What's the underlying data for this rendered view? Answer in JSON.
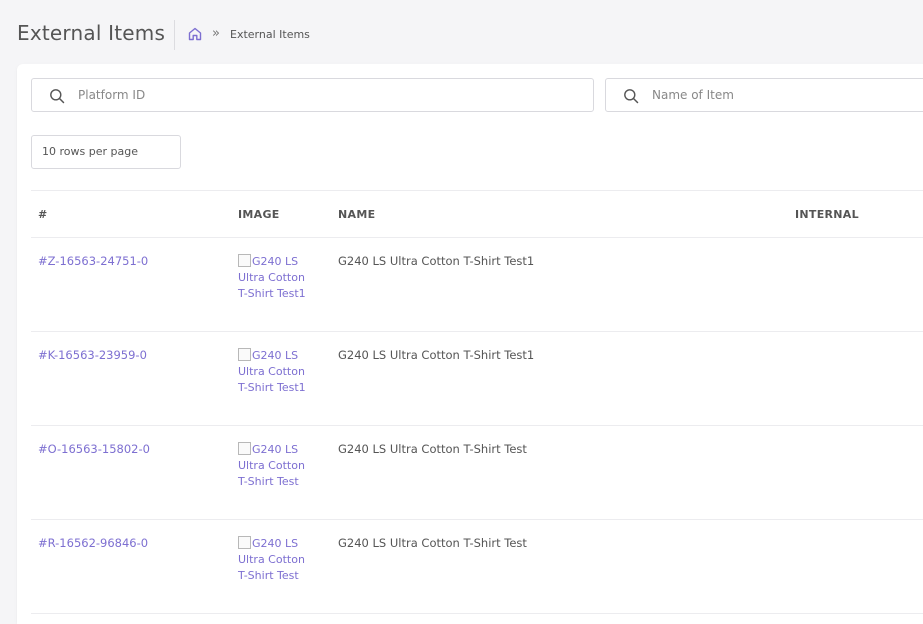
{
  "header": {
    "title": "External Items",
    "breadcrumb_separator": "»",
    "breadcrumb_current": "External Items"
  },
  "filters": {
    "platform_id_placeholder": "Platform ID",
    "platform_id_value": "",
    "item_name_placeholder": "Name of Item",
    "item_name_value": ""
  },
  "pagination": {
    "rows_per_page_label": "10 rows per page"
  },
  "table": {
    "columns": [
      "#",
      "IMAGE",
      "NAME",
      "INTERNAL"
    ],
    "rows": [
      {
        "id": "#Z-16563-24751-0",
        "image_alt": "G240 LS Ultra Cotton T-Shirt Test1",
        "name": "G240 LS Ultra Cotton T-Shirt Test1",
        "internal": ""
      },
      {
        "id": "#K-16563-23959-0",
        "image_alt": "G240 LS Ultra Cotton T-Shirt Test1",
        "name": "G240 LS Ultra Cotton T-Shirt Test1",
        "internal": ""
      },
      {
        "id": "#O-16563-15802-0",
        "image_alt": "G240 LS Ultra Cotton T-Shirt Test",
        "name": "G240 LS Ultra Cotton T-Shirt Test",
        "internal": ""
      },
      {
        "id": "#R-16562-96846-0",
        "image_alt": "G240 LS Ultra Cotton T-Shirt Test",
        "name": "G240 LS Ultra Cotton T-Shirt Test",
        "internal": ""
      }
    ]
  },
  "colors": {
    "accent": "#7d6fd1",
    "page_background": "#f5f5f7",
    "card_background": "#ffffff"
  },
  "icons": {
    "home": "home-icon",
    "search": "search-icon"
  }
}
